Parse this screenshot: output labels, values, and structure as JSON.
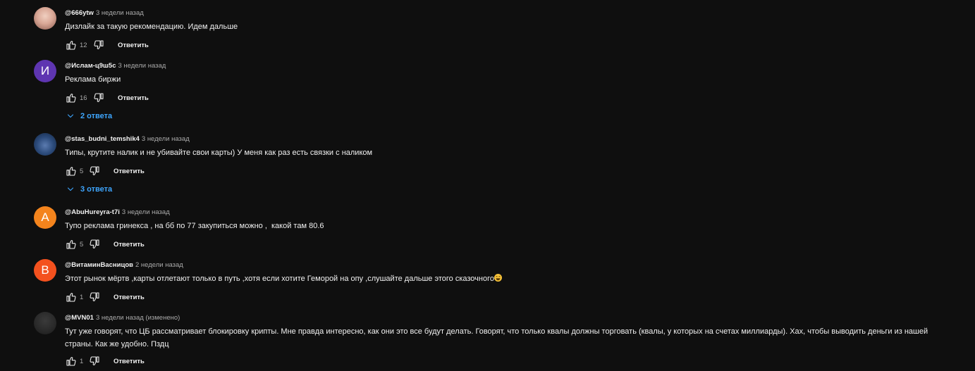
{
  "comments": [
    {
      "author": "@666ytw",
      "time": "3 недели назад",
      "text": "Дизлайк за такую рекомендацию. Идем дальше",
      "likes": "12",
      "reply_label": "Ответить",
      "avatar_color": "#d9a796"
    },
    {
      "author": "@Ислам-ц9ш5с",
      "time": "3 недели назад",
      "text": "Реклама биржи",
      "likes": "16",
      "reply_label": "Ответить",
      "avatar_letter": "И",
      "avatar_color": "#5e35b1",
      "replies_label": "2 ответа"
    },
    {
      "author": "@stas_budni_temshik4",
      "time": "3 недели назад",
      "text": "Типы, крутите налик и не убивайте свои карты) У меня как раз есть связки с наликом",
      "likes": "5",
      "reply_label": "Ответить",
      "avatar_color": "#2b4a7a",
      "replies_label": "3 ответа"
    },
    {
      "author": "@AbuHureyra-t7i",
      "time": "3 недели назад",
      "text": "Тупо реклама гринекса , на бб по 77 закупиться можно ,  какой там 80.6",
      "likes": "5",
      "reply_label": "Ответить",
      "avatar_letter": "A",
      "avatar_color": "#f4841d"
    },
    {
      "author": "@ВитаминВасницов",
      "time": "2 недели назад",
      "text": "Этот рынок мёртв ,карты отлетают только в путь ,хотя если хотите Геморой на опу ,слушайте дальше этого сказочного",
      "likes": "1",
      "reply_label": "Ответить",
      "avatar_letter": "B",
      "avatar_color": "#f4511e"
    },
    {
      "author": "@MVN01",
      "time": "3 недели назад (изменено)",
      "text": "Тут уже говорят, что ЦБ рассматривает блокировку крипты. Мне правда интересно, как они это все будут делать. Говорят, что только квалы должны торговать (квалы, у которых на счетах миллиарды). Хах, чтобы выводить деньги из нашей страны. Как же удобно. Пздц",
      "likes": "1",
      "reply_label": "Ответить",
      "avatar_color": "#2a2a2a"
    }
  ],
  "icons": {
    "like": "thumb-up-icon",
    "dislike": "thumb-down-icon",
    "expand": "chevron-down-icon",
    "emoji": "laughing-emoji"
  },
  "colors": {
    "background": "#0f0f0f",
    "text": "#f1f1f1",
    "secondary_text": "#aaaaaa",
    "link": "#3ea6ff"
  }
}
